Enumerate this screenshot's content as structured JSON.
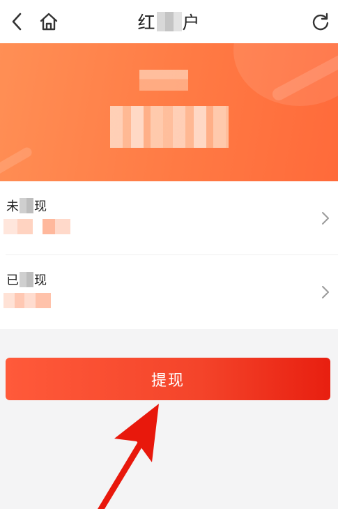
{
  "header": {
    "title_start": "红",
    "title_end": "户",
    "back_icon": "chevron-left-icon",
    "home_icon": "home-icon",
    "refresh_icon": "refresh-icon"
  },
  "rows": [
    {
      "label_start": "未",
      "label_end": "现"
    },
    {
      "label_start": "已",
      "label_end": "现"
    }
  ],
  "withdraw_button": {
    "label": "提现"
  },
  "colors": {
    "banner": "#ff7a44",
    "button": "#f4442a",
    "annotation_arrow": "#e8180c"
  }
}
